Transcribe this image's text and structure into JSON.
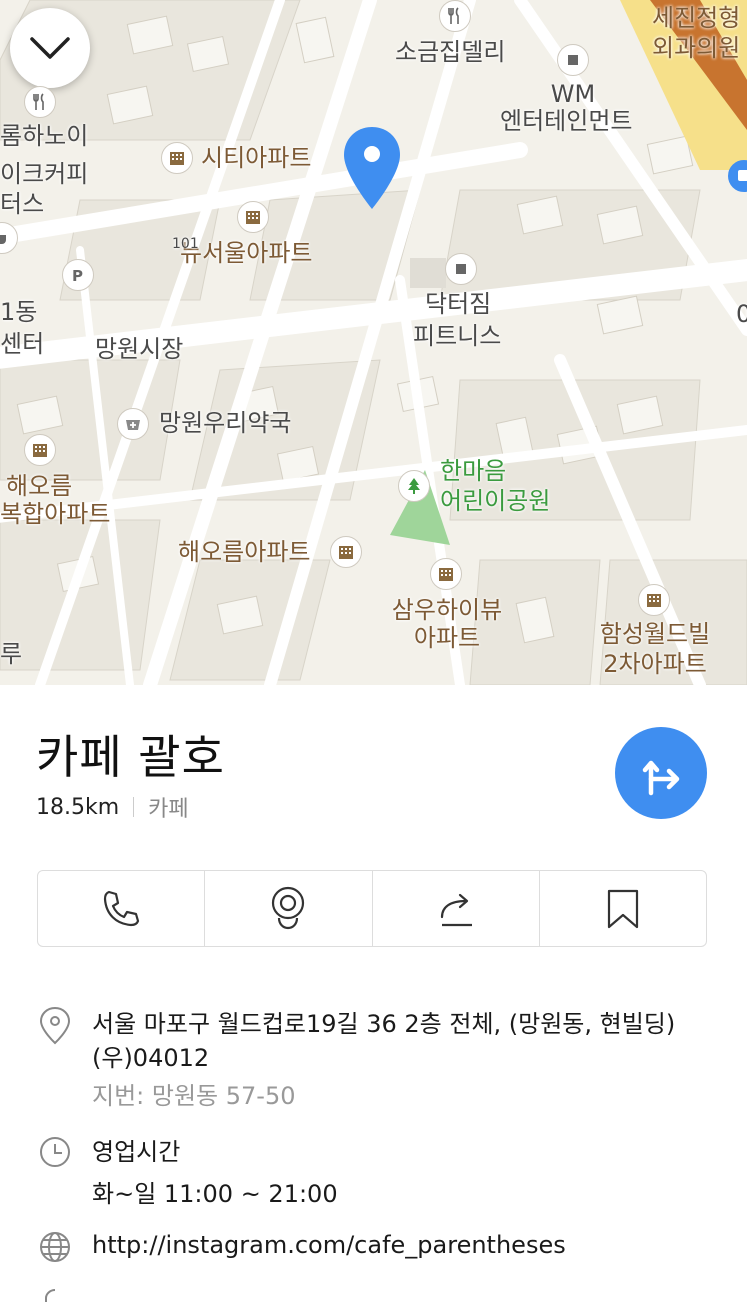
{
  "map": {
    "labels": {
      "sogeumjip": "소금집델리",
      "sejin": "세진정형",
      "sejin2": "외과의원",
      "wm": "WM",
      "wm2": "엔터테인먼트",
      "hanoi": "롬하노이",
      "coffee": "이크커피",
      "coffee2": "터스",
      "city_apt": "시티아파트",
      "newseoul": "뉴서울아파트",
      "dong": "1동",
      "center": "센터",
      "market": "망원시장",
      "doctor_gym": "닥터짐",
      "doctor_gym2": "피트니스",
      "pharmacy": "망원우리약국",
      "haeoreum_left": "해오름",
      "haeoreum_left2": "복합아파트",
      "park": "한마음",
      "park2": "어린이공원",
      "haeoreum_apt": "해오름아파트",
      "samwoo": "삼우하이뷰",
      "samwoo2": "아파트",
      "hamsung": "함성월드빌",
      "hamsung2": "2차아파트",
      "ru": "루",
      "num101": "101",
      "right_edge": "0"
    },
    "icons": {
      "collapse": "chevron-down-icon",
      "pin": "location-pin-icon"
    }
  },
  "place": {
    "name": "카페 괄호",
    "distance": "18.5km",
    "category": "카페"
  },
  "actions": [
    "phone-icon",
    "street-view-icon",
    "share-icon",
    "bookmark-icon"
  ],
  "details": {
    "address": "서울 마포구 월드컵로19길 36 2층 전체, (망원동, 현빌딩) (우)04012",
    "jibun": "지번: 망원동 57-50",
    "hours_label": "영업시간",
    "hours_value": "화~일 11:00 ~ 21:00",
    "website": "http://instagram.com/cafe_parentheses"
  },
  "colors": {
    "accent": "#3f8ef0",
    "pin": "#3f8ef0",
    "poi_brown": "#7d5a35",
    "park_green": "#3b9b3f"
  }
}
